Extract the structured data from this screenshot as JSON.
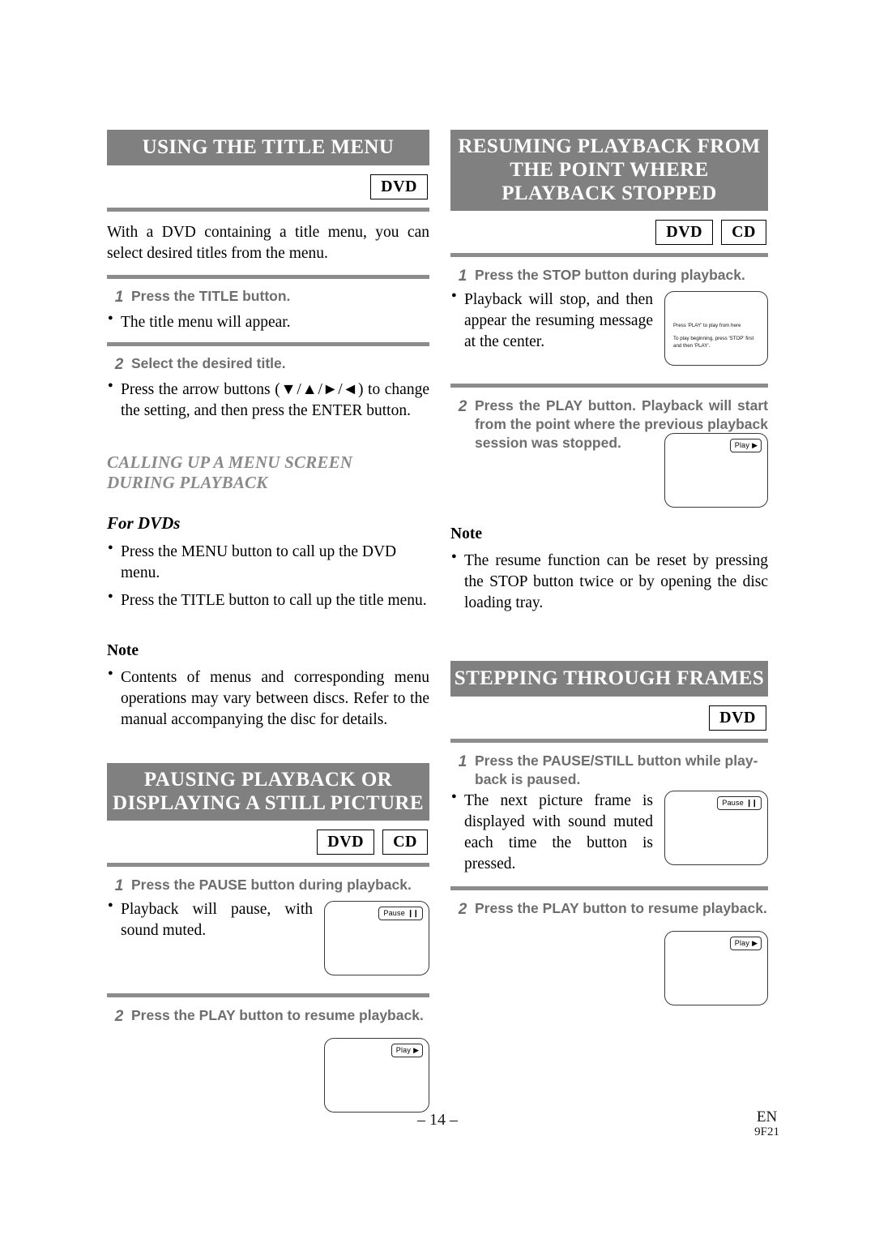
{
  "document": {
    "page_number": "– 14 –",
    "language_code": "EN",
    "doc_code": "9F21"
  },
  "sections": {
    "title_menu": {
      "heading": "USING THE TITLE MENU",
      "badges": [
        "DVD"
      ],
      "intro": "With a DVD containing a title menu, you can select desired titles from the menu.",
      "steps": [
        {
          "num": "1",
          "text": "Press the TITLE button.",
          "bullets": [
            "The title menu will appear."
          ]
        },
        {
          "num": "2",
          "text": "Select the desired title.",
          "bullets": [
            "Press the arrow buttons (▼/▲/►/◄) to change the setting, and then press the ENTER button."
          ]
        }
      ],
      "subsection": {
        "heading_line1": "CALLING UP A MENU SCREEN",
        "heading_line2": "DURING PLAYBACK",
        "subheading": "For DVDs",
        "bullets": [
          "Press the MENU button to call up the DVD menu.",
          "Press the TITLE button to call up the title menu."
        ]
      },
      "note": {
        "label": "Note",
        "bullets": [
          "Contents of menus and corresponding menu operations may vary between discs. Refer to the manual accompanying the disc for details."
        ]
      }
    },
    "resuming_playback": {
      "heading_line1": "RESUMING PLAYBACK FROM",
      "heading_line2": "THE POINT WHERE",
      "heading_line3": "PLAYBACK STOPPED",
      "badges": [
        "DVD",
        "CD"
      ],
      "steps": [
        {
          "num": "1",
          "text": "Press the STOP button during playback.",
          "bullets": [
            "Playback will stop, and then appear the resuming message at the center."
          ],
          "screen": {
            "osd_label": "",
            "osd_glyph": "",
            "messages": [
              "Press 'PLAY' to play from here",
              "To play beginning, press 'STOP' first and then 'PLAY'."
            ]
          }
        },
        {
          "num": "2",
          "text": "Press the PLAY button. Playback will start from the point where the previous playback session was stopped.",
          "bullets": [],
          "screen": {
            "osd_label": "Play",
            "osd_glyph": "▶",
            "messages": []
          }
        }
      ],
      "note": {
        "label": "Note",
        "bullets": [
          "The resume function can be reset by pressing the STOP button twice or by opening the disc loading tray."
        ]
      }
    },
    "pausing_playback": {
      "heading_line1": "PAUSING PLAYBACK OR",
      "heading_line2": "DISPLAYING A STILL PICTURE",
      "badges": [
        "DVD",
        "CD"
      ],
      "steps": [
        {
          "num": "1",
          "text": "Press the PAUSE button during playback.",
          "bullets": [
            "Playback will pause, with sound muted."
          ],
          "screen": {
            "osd_label": "Pause",
            "osd_glyph": "❙❙"
          }
        },
        {
          "num": "2",
          "text": "Press the PLAY button to resume playback.",
          "bullets": [],
          "screen": {
            "osd_label": "Play",
            "osd_glyph": "▶"
          }
        }
      ]
    },
    "stepping_frames": {
      "heading": "STEPPING THROUGH FRAMES",
      "badges": [
        "DVD"
      ],
      "steps": [
        {
          "num": "1",
          "text": "Press the PAUSE/STILL button while play-back is paused.",
          "bullets": [
            "The next picture frame is displayed with sound muted each time the button is pressed."
          ],
          "screen": {
            "osd_label": "Pause",
            "osd_glyph": "❙❙"
          }
        },
        {
          "num": "2",
          "text": "Press the PLAY button to resume playback.",
          "bullets": [],
          "screen": {
            "osd_label": "Play",
            "osd_glyph": "▶"
          }
        }
      ]
    }
  },
  "colors": {
    "header_bar": "#808080",
    "rule": "#8c8c8c",
    "step_text": "#6e6e6e",
    "subhead": "#8a8a8a"
  }
}
